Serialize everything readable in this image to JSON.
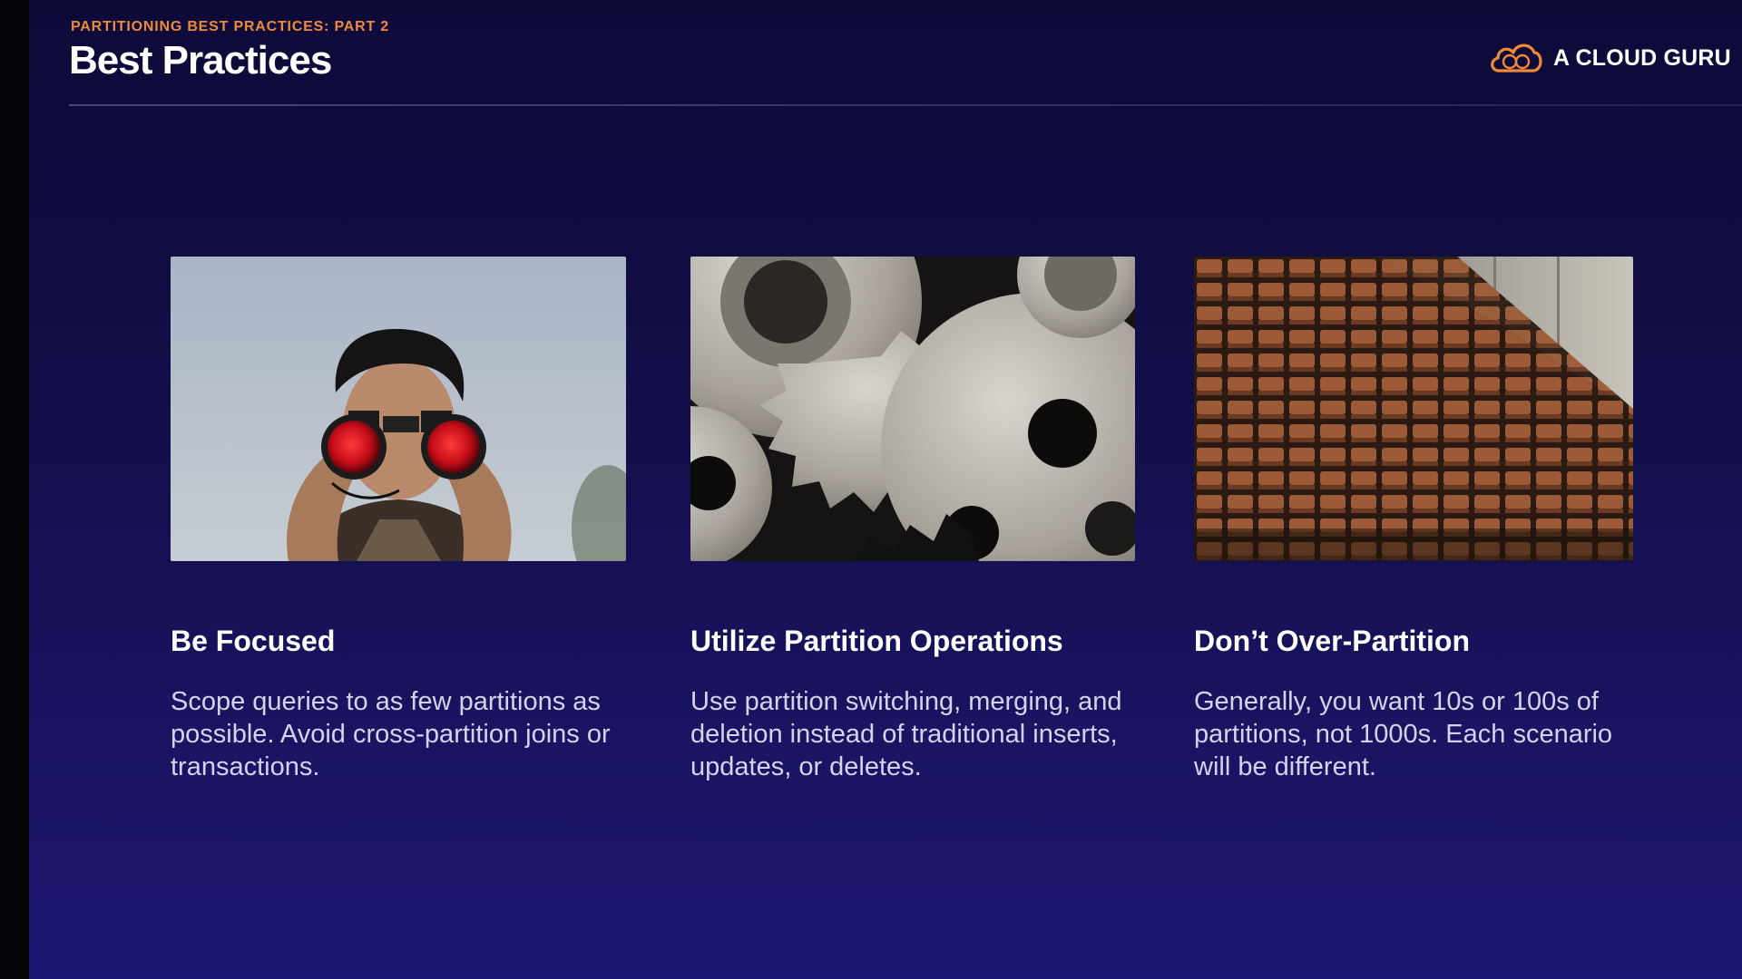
{
  "header": {
    "kicker": "PARTITIONING BEST PRACTICES: PART 2",
    "title": "Best Practices"
  },
  "brand": {
    "name": "A CLOUD GURU",
    "logo_icon": "cloud-logo-icon",
    "logo_color": "#ef8a3a"
  },
  "cards": [
    {
      "image": "person-with-binoculars-image",
      "title": "Be Focused",
      "body": "Scope queries to as few partitions as possible. Avoid cross-partition joins or transactions."
    },
    {
      "image": "metal-gears-image",
      "title": "Utilize Partition Operations",
      "body": "Use partition switching, merging, and deletion instead of traditional inserts, updates, or deletes."
    },
    {
      "image": "auditorium-seats-image",
      "title": "Don’t Over-Partition",
      "body": "Generally, you want 10s or 100s of partitions, not 1000s. Each scenario will be different."
    }
  ],
  "colors": {
    "background": "#130f4a",
    "accent": "#ee8a3e",
    "title": "#ffffff",
    "body_text": "#d5d3ea"
  }
}
